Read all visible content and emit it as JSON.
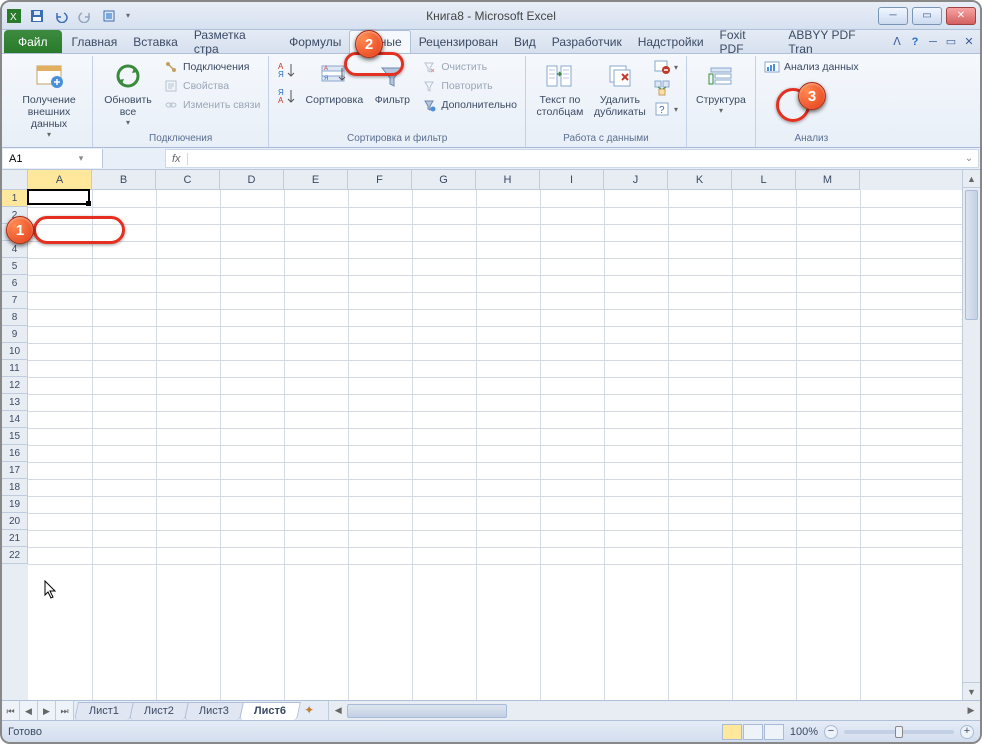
{
  "title": "Книга8 - Microsoft Excel",
  "tabs": {
    "file": "Файл",
    "items": [
      "Главная",
      "Вставка",
      "Разметка стра",
      "Формулы",
      "Данные",
      "Рецензирован",
      "Вид",
      "Разработчик",
      "Надстройки",
      "Foxit PDF",
      "ABBYY PDF Tran"
    ],
    "active_index": 4
  },
  "ribbon": {
    "g1": {
      "btn": "Получение\nвнешних данных",
      "label": ""
    },
    "g2": {
      "btn": "Обновить\nвсе",
      "items": [
        "Подключения",
        "Свойства",
        "Изменить связи"
      ],
      "label": "Подключения"
    },
    "g3": {
      "sort_az": "А↓Я",
      "sort_za": "Я↓А",
      "sort": "Сортировка",
      "filter": "Фильтр",
      "clear": "Очистить",
      "reapply": "Повторить",
      "advanced": "Дополнительно",
      "label": "Сортировка и фильтр"
    },
    "g4": {
      "text_cols": "Текст по\nстолбцам",
      "remove_dup": "Удалить\nдубликаты",
      "label": "Работа с данными"
    },
    "g5": {
      "btn": "Структура",
      "label": ""
    },
    "g6": {
      "btn": "Анализ данных",
      "label": "Анализ"
    }
  },
  "namebox": "A1",
  "fx": "fx",
  "columns": [
    "A",
    "B",
    "C",
    "D",
    "E",
    "F",
    "G",
    "H",
    "I",
    "J",
    "K",
    "L",
    "M"
  ],
  "rows_visible": 22,
  "active_cell": "A1",
  "sheets": [
    "Лист1",
    "Лист2",
    "Лист3",
    "Лист6"
  ],
  "active_sheet_index": 3,
  "status": "Готово",
  "zoom": "100%"
}
